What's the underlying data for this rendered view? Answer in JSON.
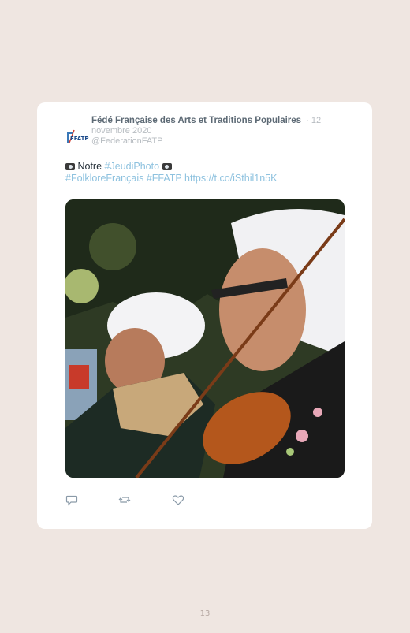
{
  "tweet": {
    "author_name": "Fédé Française des Arts et Traditions Populaires",
    "separator": "·",
    "date": "12 novembre 2020",
    "handle": "@FederationFATP",
    "avatar_text": "FFATP",
    "text_notre": "Notre",
    "hashtag_jeudi": "#JeudiPhoto",
    "hashtag_folklore": "#FolkloreFrançais",
    "hashtag_ffatp": "#FFATP",
    "link": "https://t.co/iSthil1n5K",
    "icons": [
      "camera-icon",
      "reply-icon",
      "retweet-icon",
      "like-icon"
    ]
  },
  "page": {
    "number": "13"
  },
  "colors": {
    "background": "#efe6e1",
    "card": "#ffffff",
    "link": "#8ec2df",
    "muted": "#b7bcc1"
  }
}
